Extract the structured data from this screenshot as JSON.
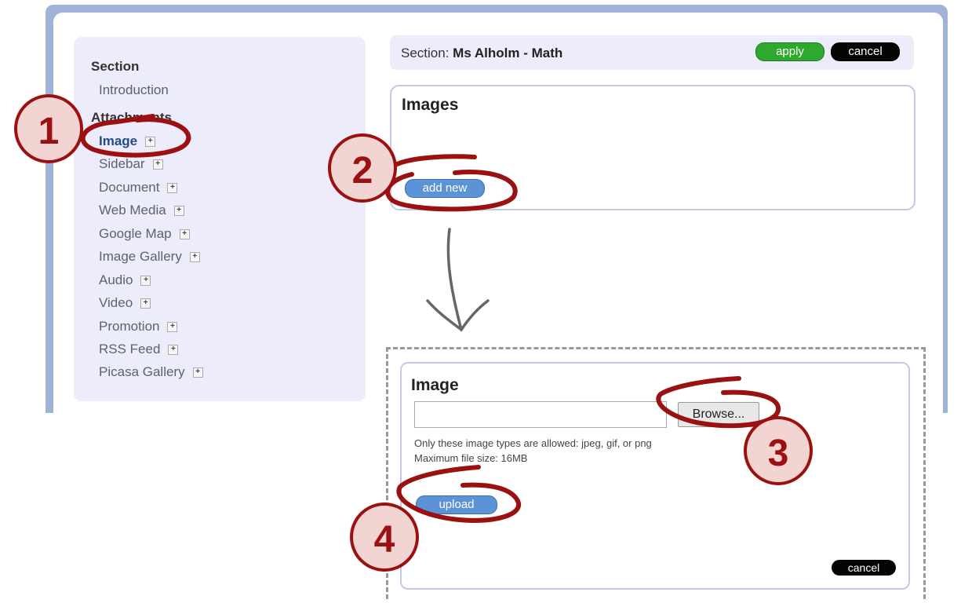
{
  "sidebar": {
    "section_heading": "Section",
    "intro": "Introduction",
    "attachments_heading": "Attachments",
    "items": [
      {
        "label": "Image"
      },
      {
        "label": "Sidebar"
      },
      {
        "label": "Document"
      },
      {
        "label": "Web Media"
      },
      {
        "label": "Google Map"
      },
      {
        "label": "Image Gallery"
      },
      {
        "label": "Audio"
      },
      {
        "label": "Video"
      },
      {
        "label": "Promotion"
      },
      {
        "label": "RSS Feed"
      },
      {
        "label": "Picasa Gallery"
      }
    ],
    "expand_glyph": "+"
  },
  "topbar": {
    "section_label": "Section:",
    "section_name": "Ms Alholm - Math",
    "apply_label": "apply",
    "cancel_label": "cancel"
  },
  "images_panel": {
    "title": "Images",
    "add_new_label": "add new"
  },
  "image_panel": {
    "title": "Image",
    "browse_label": "Browse...",
    "hint_types": "Only these image types are allowed: jpeg, gif, or png",
    "hint_size": "Maximum file size: 16MB",
    "upload_label": "upload",
    "cancel_label": "cancel"
  },
  "annotations": {
    "step1": "1",
    "step2": "2",
    "step3": "3",
    "step4": "4"
  },
  "colors": {
    "frame": "#9fb3d9",
    "sidebar_bg": "#ececfa",
    "apply_green": "#2fa82f",
    "button_blue": "#5c93d6",
    "annotation_red": "#9b1111"
  }
}
